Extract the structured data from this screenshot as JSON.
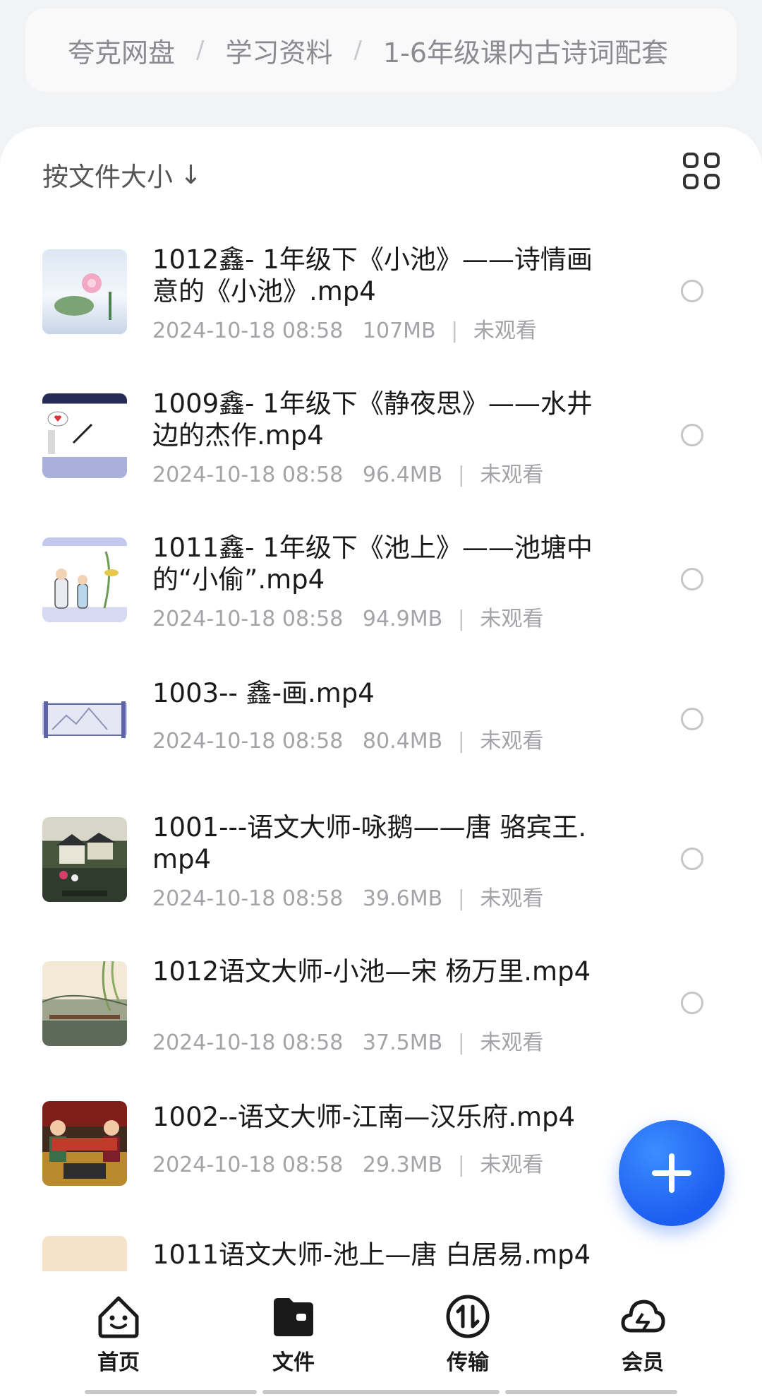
{
  "breadcrumb": [
    "夸克网盘",
    "学习资料",
    "1-6年级课内古诗词配套"
  ],
  "breadcrumb_separator": "/",
  "sort": {
    "label": "按文件大小",
    "arrow": "↓"
  },
  "files": [
    {
      "name": "1012鑫- 1年级下《小池》——诗情画意的《小池》.mp4",
      "date": "2024-10-18 08:58",
      "size": "107MB",
      "status": "未观看"
    },
    {
      "name": "1009鑫- 1年级下《静夜思》——水井边的杰作.mp4",
      "date": "2024-10-18 08:58",
      "size": "96.4MB",
      "status": "未观看"
    },
    {
      "name": "1011鑫-  1年级下《池上》——池塘中的“小偷”.mp4",
      "date": "2024-10-18 08:58",
      "size": "94.9MB",
      "status": "未观看"
    },
    {
      "name": "1003-- 鑫-画.mp4",
      "date": "2024-10-18 08:58",
      "size": "80.4MB",
      "status": "未观看"
    },
    {
      "name": "1001---语文大师-咏鹅——唐  骆宾王.mp4",
      "date": "2024-10-18 08:58",
      "size": "39.6MB",
      "status": "未观看"
    },
    {
      "name": "1012语文大师-小池—宋  杨万里.mp4",
      "date": "2024-10-18 08:58",
      "size": "37.5MB",
      "status": "未观看"
    },
    {
      "name": "1002--语文大师-江南—汉乐府.mp4",
      "date": "2024-10-18 08:58",
      "size": "29.3MB",
      "status": "未观看"
    },
    {
      "name": "1011语文大师-池上—唐  白居易.mp4",
      "date": "",
      "size": "",
      "status": ""
    }
  ],
  "tabs": [
    {
      "label": "首页",
      "icon": "smiley-home-icon"
    },
    {
      "label": "文件",
      "icon": "folder-icon"
    },
    {
      "label": "传输",
      "icon": "transfer-icon"
    },
    {
      "label": "会员",
      "icon": "cloud-icon"
    }
  ],
  "colors": {
    "accent": "#1c5ef0",
    "text": "#1a1a1a",
    "meta": "#a2a4a8"
  }
}
